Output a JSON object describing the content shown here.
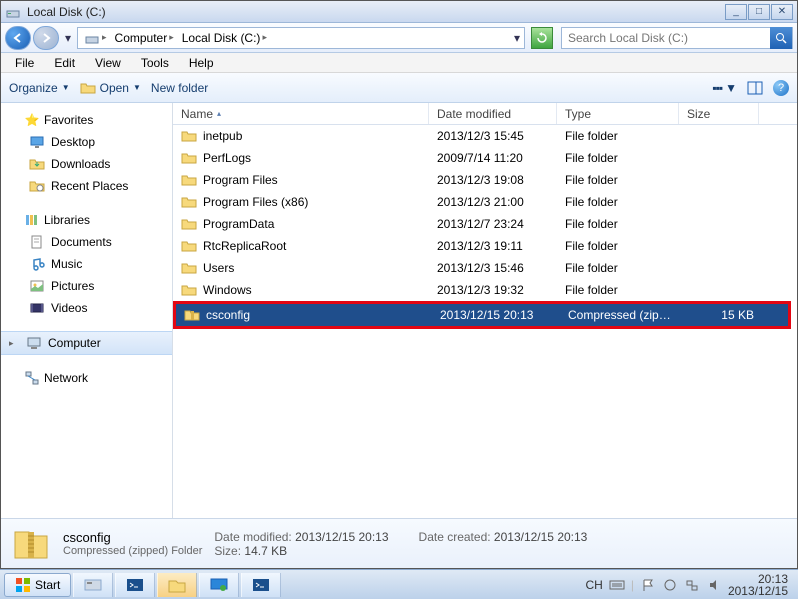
{
  "titlebar": {
    "title": "Local Disk (C:)"
  },
  "nav": {
    "crumbs": [
      "Computer",
      "Local Disk (C:)"
    ],
    "search_placeholder": "Search Local Disk (C:)"
  },
  "menu": {
    "file": "File",
    "edit": "Edit",
    "view": "View",
    "tools": "Tools",
    "help": "Help"
  },
  "cmd": {
    "organize": "Organize",
    "open": "Open",
    "newfolder": "New folder"
  },
  "sidebar": {
    "favorites": {
      "label": "Favorites",
      "items": [
        "Desktop",
        "Downloads",
        "Recent Places"
      ]
    },
    "libraries": {
      "label": "Libraries",
      "items": [
        "Documents",
        "Music",
        "Pictures",
        "Videos"
      ]
    },
    "computer": {
      "label": "Computer"
    },
    "network": {
      "label": "Network"
    }
  },
  "columns": {
    "name": "Name",
    "date": "Date modified",
    "type": "Type",
    "size": "Size"
  },
  "colwidths": {
    "name": 256,
    "date": 128,
    "type": 122,
    "size": 80
  },
  "files": [
    {
      "name": "inetpub",
      "date": "2013/12/3 15:45",
      "type": "File folder",
      "size": "",
      "icon": "folder"
    },
    {
      "name": "PerfLogs",
      "date": "2009/7/14 11:20",
      "type": "File folder",
      "size": "",
      "icon": "folder"
    },
    {
      "name": "Program Files",
      "date": "2013/12/3 19:08",
      "type": "File folder",
      "size": "",
      "icon": "folder"
    },
    {
      "name": "Program Files (x86)",
      "date": "2013/12/3 21:00",
      "type": "File folder",
      "size": "",
      "icon": "folder"
    },
    {
      "name": "ProgramData",
      "date": "2013/12/7 23:24",
      "type": "File folder",
      "size": "",
      "icon": "folder"
    },
    {
      "name": "RtcReplicaRoot",
      "date": "2013/12/3 19:11",
      "type": "File folder",
      "size": "",
      "icon": "folder"
    },
    {
      "name": "Users",
      "date": "2013/12/3 15:46",
      "type": "File folder",
      "size": "",
      "icon": "folder"
    },
    {
      "name": "Windows",
      "date": "2013/12/3 19:32",
      "type": "File folder",
      "size": "",
      "icon": "folder"
    },
    {
      "name": "csconfig",
      "date": "2013/12/15 20:13",
      "type": "Compressed (zippe...",
      "size": "15 KB",
      "icon": "zip",
      "selected": true
    }
  ],
  "details": {
    "name": "csconfig",
    "type": "Compressed (zipped) Folder",
    "modified_label": "Date modified:",
    "modified": "2013/12/15 20:13",
    "created_label": "Date created:",
    "created": "2013/12/15 20:13",
    "size_label": "Size:",
    "size": "14.7 KB"
  },
  "taskbar": {
    "start": "Start",
    "lang": "CH",
    "time": "20:13",
    "date": "2013/12/15"
  }
}
